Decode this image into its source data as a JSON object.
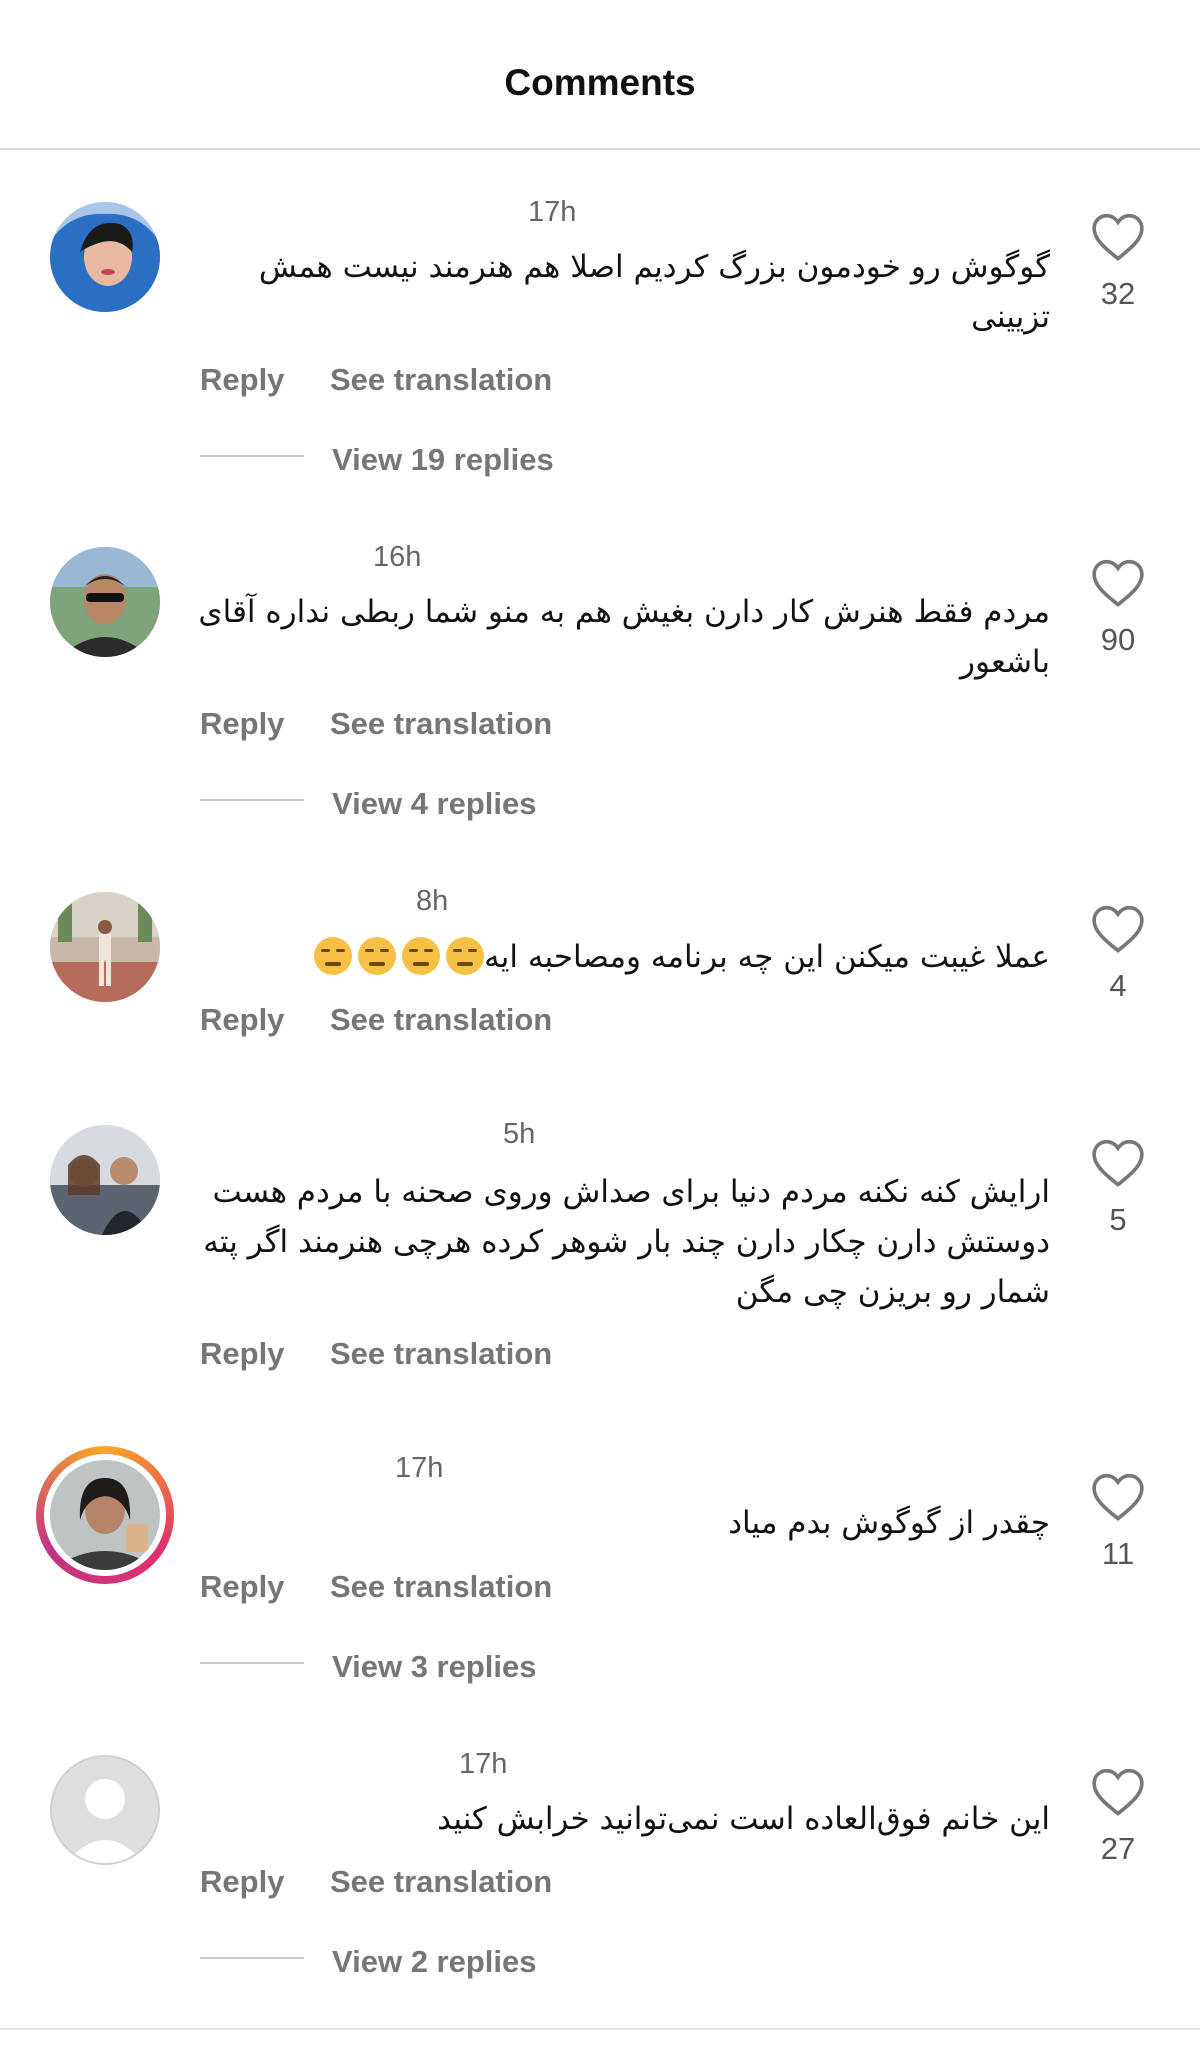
{
  "header": {
    "title": "Comments"
  },
  "comments": [
    {
      "time": "17h",
      "text": "گوگوش رو خودمون بزرگ کردیم اصلا هم هنرمند نیست همش تزیینی",
      "reply_label": "Reply",
      "translate_label": "See translation",
      "view_replies": "View 19 replies",
      "likes": "32"
    },
    {
      "time": "16h",
      "text": "مردم فقط هنرش کار دارن بغیش هم به منو شما ربطی نداره آقای باشعور",
      "reply_label": "Reply",
      "translate_label": "See translation",
      "view_replies": "View 4 replies",
      "likes": "90"
    },
    {
      "time": "8h",
      "text": "عملا غیبت میکنن این چه برنامه ومصاحبه ایه",
      "reply_label": "Reply",
      "translate_label": "See translation",
      "likes": "4"
    },
    {
      "time": "5h",
      "text": "ارایش کنه نکنه مردم دنیا برای صداش وروی صحنه با مردم هست دوستش دارن چکار دارن چند بار شوهر کرده هرچی هنرمند اگر پته شمار رو بریزن چی مگن",
      "reply_label": "Reply",
      "translate_label": "See translation",
      "likes": "5"
    },
    {
      "time": "17h",
      "text": "چقدر از گوگوش بدم میاد",
      "reply_label": "Reply",
      "translate_label": "See translation",
      "view_replies": "View 3 replies",
      "likes": "11"
    },
    {
      "time": "17h",
      "text": "این خانم فوق‌العاده است نمی‌توانید خرابش کنید",
      "reply_label": "Reply",
      "translate_label": "See translation",
      "view_replies": "View 2 replies",
      "likes": "27"
    }
  ],
  "icons": {
    "like": "heart-outline-icon"
  },
  "colors": {
    "muted_text": "#767676",
    "story_ring": "#e1306c"
  }
}
